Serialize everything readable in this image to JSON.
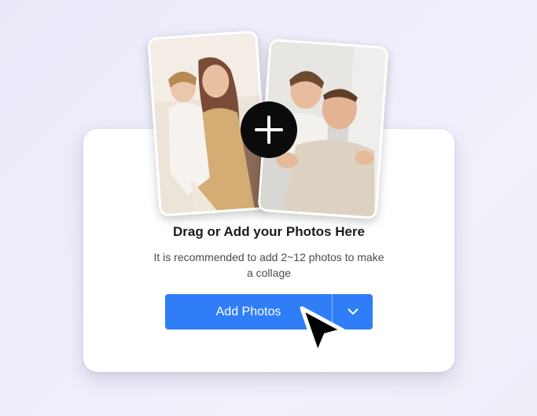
{
  "upload": {
    "title": "Drag or Add your Photos Here",
    "subtitle_line1": "It is recommended to add 2~12 photos to make",
    "subtitle_line2": "a collage",
    "add_photos_label": "Add Photos"
  },
  "icons": {
    "plus": "plus-icon",
    "dropdown": "chevron-down-icon",
    "cursor": "mouse-pointer-icon"
  },
  "colors": {
    "accent": "#2f7ef7",
    "plus_bg": "#0b0b0b",
    "card_bg": "#ffffff",
    "title_text": "#1b1b1f"
  }
}
